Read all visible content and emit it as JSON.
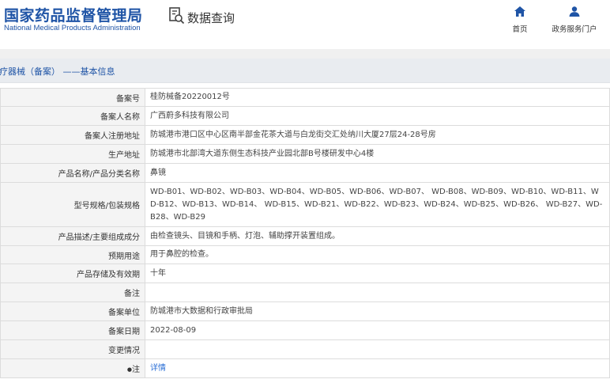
{
  "header": {
    "agency_cn": "国家药品监督管理局",
    "agency_en": "National Medical Products Administration",
    "query_title": "数据查询",
    "nav": [
      {
        "label": "首页",
        "icon": "home-icon"
      },
      {
        "label": "政务服务门户",
        "icon": "person-icon"
      }
    ]
  },
  "section": {
    "title": "医疗器械（备案） ——基本信息"
  },
  "colors": {
    "brand_blue": "#1f54a6",
    "link_blue": "#2b6fd6",
    "label_bg": "#f4f4f4"
  },
  "records": [
    {
      "label": "备案号",
      "value": "桂防械备20220012号"
    },
    {
      "label": "备案人名称",
      "value": "广西蔚多科技有限公司"
    },
    {
      "label": "备案人注册地址",
      "value": "防城港市港口区中心区南半部金花茶大道与白龙街交汇处纳川大厦27层24-28号房"
    },
    {
      "label": "生产地址",
      "value": "防城港市北部湾大道东侧生态科技产业园北部B号楼研发中心4楼"
    },
    {
      "label": "产品名称/产品分类名称",
      "value": "鼻镜"
    },
    {
      "label": "型号规格/包装规格",
      "value": "WD-B01、WD-B02、WD-B03、WD-B04、WD-B05、WD-B06、WD-B07、 WD-B08、WD-B09、WD-B10、WD-B11、WD-B12、WD-B13、WD-B14、 WD-B15、WD-B21、WD-B22、WD-B23、WD-B24、WD-B25、WD-B26、 WD-B27、WD-B28、WD-B29"
    },
    {
      "label": "产品描述/主要组成成分",
      "value": "由检查镜头、目镜和手柄、灯泡、辅助撑开装置组成。"
    },
    {
      "label": "预期用途",
      "value": "用于鼻腔的检查。"
    },
    {
      "label": "产品存储及有效期",
      "value": "十年"
    },
    {
      "label": "备注",
      "value": ""
    },
    {
      "label": "备案单位",
      "value": "防城港市大数据和行政审批局"
    },
    {
      "label": "备案日期",
      "value": "2022-08-09"
    },
    {
      "label": "变更情况",
      "value": ""
    },
    {
      "label": "注",
      "value": "详情"
    }
  ]
}
